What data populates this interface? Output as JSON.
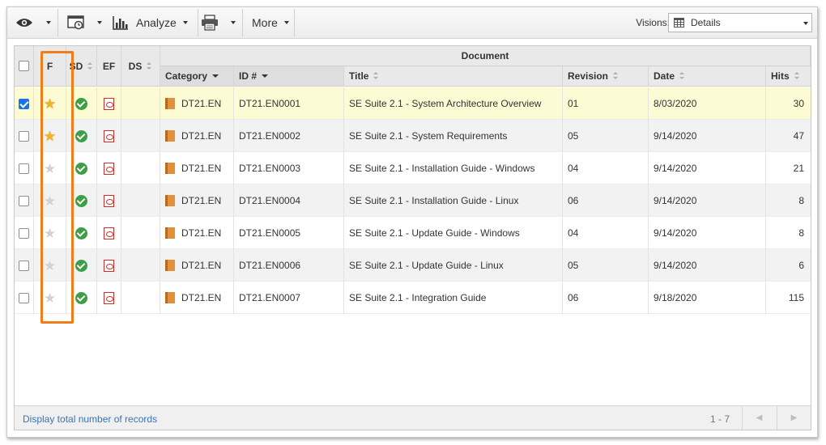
{
  "toolbar": {
    "analyze_label": "Analyze",
    "more_label": "More",
    "visions_label": "Visions:",
    "visions_value": "Details"
  },
  "grid": {
    "group_header": "Document",
    "columns": {
      "f": "F",
      "sd": "SD",
      "ef": "EF",
      "ds": "DS",
      "category": "Category",
      "id": "ID #",
      "title": "Title",
      "revision": "Revision",
      "date": "Date",
      "hits": "Hits"
    },
    "rows": [
      {
        "selected": true,
        "favorite": true,
        "category": "DT21.EN",
        "id": "DT21.EN0001",
        "title": "SE Suite 2.1 - System Architecture Overview",
        "revision": "01",
        "date": "8/03/2020",
        "hits": "30"
      },
      {
        "selected": false,
        "favorite": true,
        "category": "DT21.EN",
        "id": "DT21.EN0002",
        "title": "SE Suite 2.1 - System Requirements",
        "revision": "05",
        "date": "9/14/2020",
        "hits": "47"
      },
      {
        "selected": false,
        "favorite": false,
        "category": "DT21.EN",
        "id": "DT21.EN0003",
        "title": "SE Suite 2.1 - Installation Guide - Windows",
        "revision": "04",
        "date": "9/14/2020",
        "hits": "21"
      },
      {
        "selected": false,
        "favorite": false,
        "category": "DT21.EN",
        "id": "DT21.EN0004",
        "title": "SE Suite 2.1 - Installation Guide - Linux",
        "revision": "06",
        "date": "9/14/2020",
        "hits": "8"
      },
      {
        "selected": false,
        "favorite": false,
        "category": "DT21.EN",
        "id": "DT21.EN0005",
        "title": "SE Suite 2.1 - Update Guide - Windows",
        "revision": "04",
        "date": "9/14/2020",
        "hits": "8"
      },
      {
        "selected": false,
        "favorite": false,
        "category": "DT21.EN",
        "id": "DT21.EN0006",
        "title": "SE Suite 2.1 - Update Guide - Linux",
        "revision": "05",
        "date": "9/14/2020",
        "hits": "6"
      },
      {
        "selected": false,
        "favorite": false,
        "category": "DT21.EN",
        "id": "DT21.EN0007",
        "title": "SE Suite 2.1 - Integration Guide",
        "revision": "06",
        "date": "9/18/2020",
        "hits": "115"
      }
    ]
  },
  "footer": {
    "records_link": "Display total number of records",
    "pager_text": "1 - 7"
  },
  "colors": {
    "highlight": "#f07d1a",
    "selected_row": "#fdfbd4",
    "link": "#3a73b5",
    "status_green": "#3c9f45"
  },
  "icons": {
    "view": "eye-icon",
    "schedule": "calendar-window-icon",
    "analyze": "bar-chart-icon",
    "print": "printer-icon",
    "visions": "table-grid-icon",
    "favorite": "star-icon",
    "status": "check-badge-icon",
    "file": "pdf-icon",
    "category": "book-icon"
  }
}
